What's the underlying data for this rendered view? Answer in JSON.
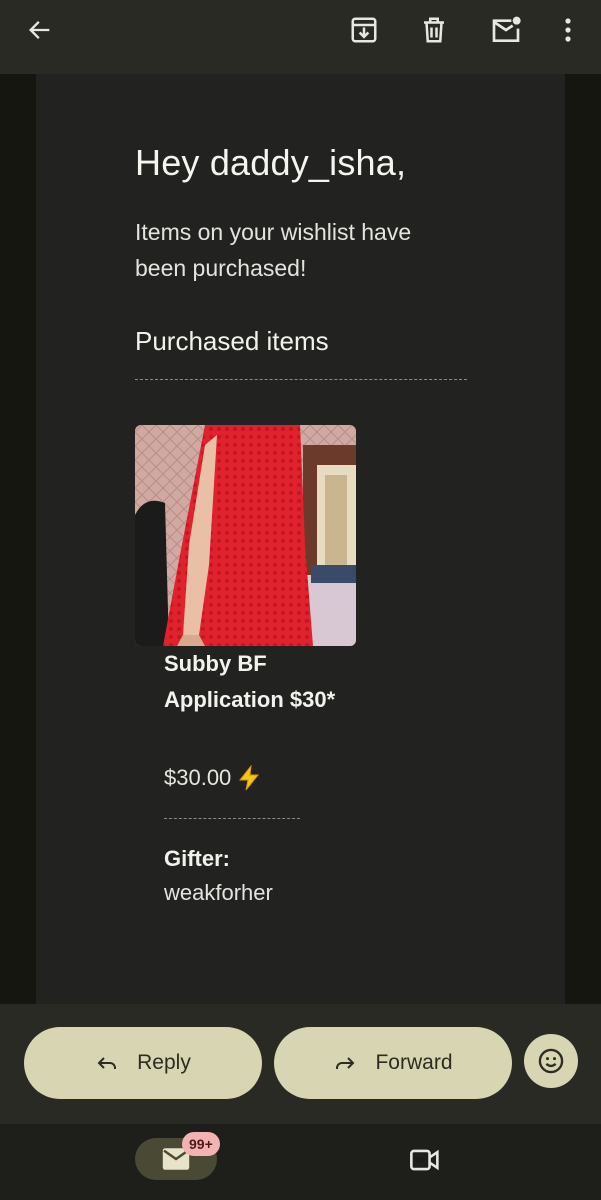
{
  "email": {
    "greeting": "Hey daddy_isha,",
    "intro": "Items on your wishlist have been purchased!",
    "section_title": "Purchased items",
    "item": {
      "name": "Subby BF Application $30*",
      "price": "$30.00",
      "price_icon": "lightning-icon"
    },
    "gifter_label": "Gifter:",
    "gifter_name": "weakforher"
  },
  "actions": {
    "reply_label": "Reply",
    "forward_label": "Forward"
  },
  "bottom_nav": {
    "mail_badge": "99+"
  },
  "colors": {
    "pill_bg": "#d8d6b2",
    "badge_bg": "#f4b3b3",
    "background": "#222220"
  }
}
